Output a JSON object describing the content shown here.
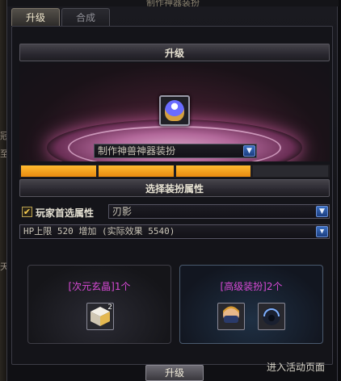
{
  "window": {
    "title": "制作神器装扮"
  },
  "tabs": [
    {
      "label": "升级",
      "active": true
    },
    {
      "label": "合成",
      "active": false
    }
  ],
  "upgrade_section": {
    "title": "升级"
  },
  "item_selector": {
    "value": "制作神兽神器装扮"
  },
  "progress": {
    "segments_total": 4,
    "segments_filled": 3
  },
  "attribute_section": {
    "title": "选择装扮属性"
  },
  "player_pref": {
    "checked": true,
    "label": "玩家首选属性",
    "value": "刃影"
  },
  "attribute_dropdown": {
    "value": "HP上限 520 增加 (实际效果 5540)"
  },
  "materials_left": {
    "title": "[次元玄晶]1个",
    "qty": "2"
  },
  "materials_right": {
    "title": "[高级装扮]2个"
  },
  "footer": {
    "event_link": "进入活动页面",
    "upgrade_button": "升级"
  },
  "side_glyphs": [
    "冠",
    "至",
    "天"
  ],
  "colors": {
    "accent_orange": "#f0a020",
    "material_title": "#d84ad6",
    "dropdown_blue": "#2a5aa8"
  },
  "icons": [
    "checkbox-icon",
    "dropdown-arrow-icon",
    "cube-material-icon",
    "masked-avatar-icon",
    "dark-helmet-icon",
    "artifact-item-icon"
  ]
}
